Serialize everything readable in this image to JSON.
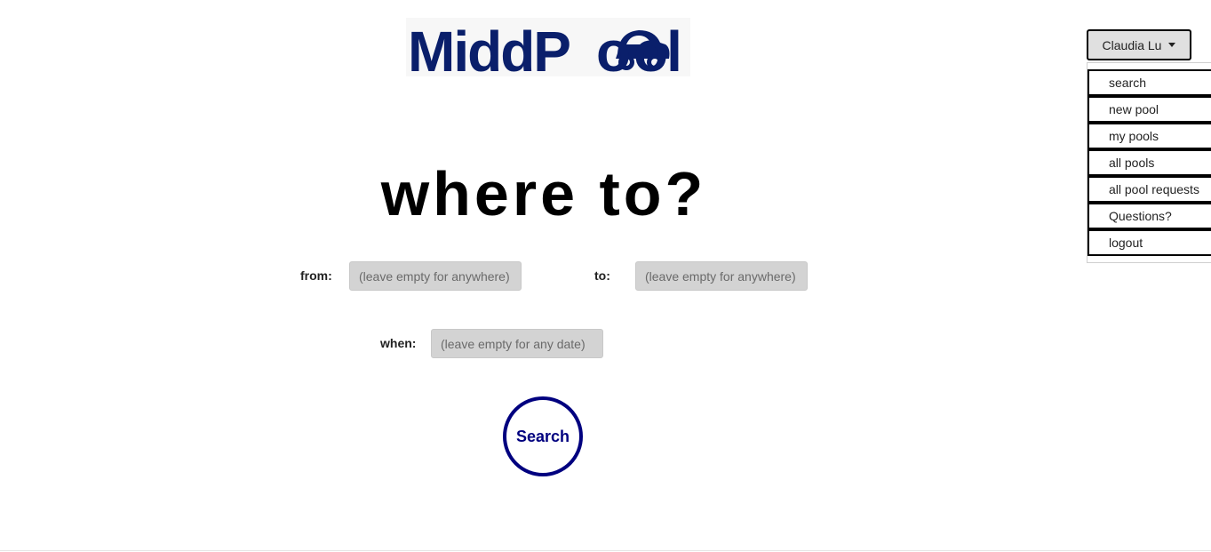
{
  "brand": {
    "logo_text_part1": "MiddP",
    "logo_text_part2": "ol",
    "logo_color": "#0a1f6b"
  },
  "user_menu": {
    "user_name": "Claudia Lu",
    "items": [
      {
        "label": "search"
      },
      {
        "label": "new pool"
      },
      {
        "label": "my pools"
      },
      {
        "label": "all pools"
      },
      {
        "label": "all pool requests"
      },
      {
        "label": "Questions?"
      },
      {
        "label": "logout"
      }
    ]
  },
  "main": {
    "headline": "where to?",
    "from_label": "from:",
    "from_placeholder": "(leave empty for anywhere)",
    "to_label": "to:",
    "to_placeholder": "(leave empty for anywhere)",
    "when_label": "when:",
    "when_placeholder": "(leave empty for any date)",
    "search_label": "Search"
  },
  "colors": {
    "accent": "#00007f",
    "input_bg": "#d3d3d3"
  }
}
